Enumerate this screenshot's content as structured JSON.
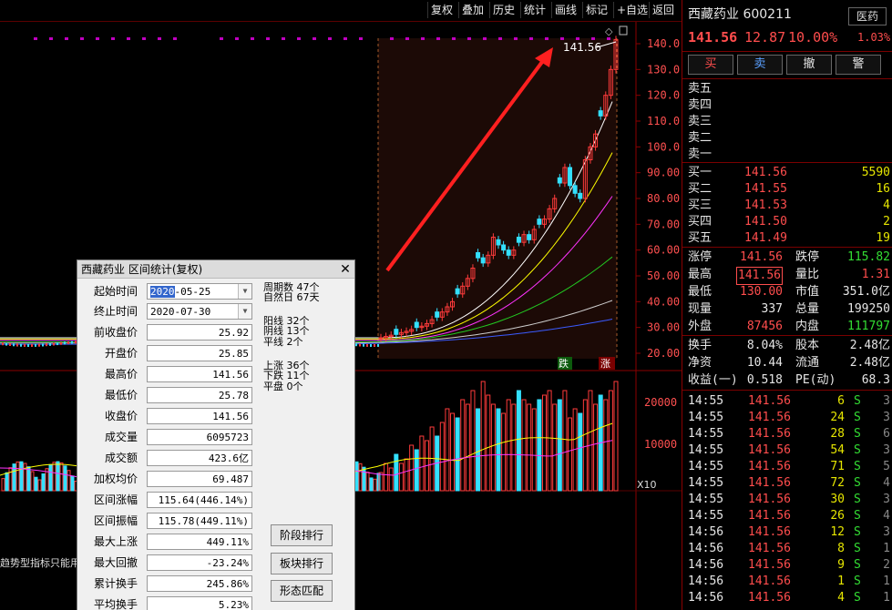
{
  "toolbar": {
    "buttons": [
      "复权",
      "叠加",
      "历史",
      "统计",
      "画线",
      "标记",
      "+自选",
      "返回"
    ]
  },
  "chart": {
    "price_axis": [
      "140.0",
      "130.0",
      "120.0",
      "110.0",
      "100.0",
      "90.00",
      "80.00",
      "70.00",
      "60.00",
      "50.00",
      "40.00",
      "30.00",
      "20.00"
    ],
    "volume_axis": [
      "20000",
      "10000"
    ],
    "volume_unit": "X10",
    "high_label": "141.56",
    "badge_down": "跌",
    "badge_up": "涨",
    "indicator_note": "趋势型指标只能用"
  },
  "panel": {
    "name": "西藏药业 600211",
    "sector": "医药",
    "price": "141.56",
    "change": "12.87",
    "change_pct": "10.00%",
    "turnover_pct": "1.03%",
    "actions": [
      "买",
      "卖",
      "撤",
      "警"
    ],
    "asks": [
      {
        "label": "卖五",
        "price": "",
        "vol": ""
      },
      {
        "label": "卖四",
        "price": "",
        "vol": ""
      },
      {
        "label": "卖三",
        "price": "",
        "vol": ""
      },
      {
        "label": "卖二",
        "price": "",
        "vol": ""
      },
      {
        "label": "卖一",
        "price": "",
        "vol": ""
      }
    ],
    "bids": [
      {
        "label": "买一",
        "price": "141.56",
        "vol": "5590"
      },
      {
        "label": "买二",
        "price": "141.55",
        "vol": "16"
      },
      {
        "label": "买三",
        "price": "141.53",
        "vol": "4"
      },
      {
        "label": "买四",
        "price": "141.50",
        "vol": "2"
      },
      {
        "label": "买五",
        "price": "141.49",
        "vol": "19"
      }
    ],
    "quote": [
      {
        "l1": "涨停",
        "v1": "141.56",
        "l2": "跌停",
        "v2": "115.82"
      },
      {
        "l1": "最高",
        "v1": "141.56",
        "l2": "量比",
        "v2": "1.31"
      },
      {
        "l1": "最低",
        "v1": "130.00",
        "l2": "市值",
        "v2": "351.0亿"
      },
      {
        "l1": "现量",
        "v1": "337",
        "l2": "总量",
        "v2": "199250"
      },
      {
        "l1": "外盘",
        "v1": "87456",
        "l2": "内盘",
        "v2": "111797"
      }
    ],
    "fund": [
      {
        "l1": "换手",
        "v1": "8.04%",
        "l2": "股本",
        "v2": "2.48亿"
      },
      {
        "l1": "净资",
        "v1": "10.44",
        "l2": "流通",
        "v2": "2.48亿"
      },
      {
        "l1": "收益(一)",
        "v1": "0.518",
        "l2": "PE(动)",
        "v2": "68.3"
      }
    ],
    "ticks": [
      {
        "t": "14:55",
        "p": "141.56",
        "v": "6",
        "s": "S",
        "n": "3"
      },
      {
        "t": "14:55",
        "p": "141.56",
        "v": "24",
        "s": "S",
        "n": "3"
      },
      {
        "t": "14:55",
        "p": "141.56",
        "v": "28",
        "s": "S",
        "n": "6"
      },
      {
        "t": "14:55",
        "p": "141.56",
        "v": "54",
        "s": "S",
        "n": "3"
      },
      {
        "t": "14:55",
        "p": "141.56",
        "v": "71",
        "s": "S",
        "n": "5"
      },
      {
        "t": "14:55",
        "p": "141.56",
        "v": "72",
        "s": "S",
        "n": "4"
      },
      {
        "t": "14:55",
        "p": "141.56",
        "v": "30",
        "s": "S",
        "n": "3"
      },
      {
        "t": "14:55",
        "p": "141.56",
        "v": "26",
        "s": "S",
        "n": "4"
      },
      {
        "t": "14:56",
        "p": "141.56",
        "v": "12",
        "s": "S",
        "n": "3"
      },
      {
        "t": "14:56",
        "p": "141.56",
        "v": "8",
        "s": "S",
        "n": "1"
      },
      {
        "t": "14:56",
        "p": "141.56",
        "v": "9",
        "s": "S",
        "n": "2"
      },
      {
        "t": "14:56",
        "p": "141.56",
        "v": "1",
        "s": "S",
        "n": "1"
      },
      {
        "t": "14:56",
        "p": "141.56",
        "v": "4",
        "s": "S",
        "n": "1"
      }
    ]
  },
  "dialog": {
    "title": "西藏药业 区间统计(复权)",
    "start_label": "起始时间",
    "start_value": "2020-05-25",
    "end_label": "终止时间",
    "end_value": "2020-07-30",
    "rows": [
      {
        "label": "前收盘价",
        "value": "25.92"
      },
      {
        "label": "开盘价",
        "value": "25.85"
      },
      {
        "label": "最高价",
        "value": "141.56"
      },
      {
        "label": "最低价",
        "value": "25.78"
      },
      {
        "label": "收盘价",
        "value": "141.56"
      },
      {
        "label": "成交量",
        "value": "6095723"
      },
      {
        "label": "成交额",
        "value": "423.6亿"
      },
      {
        "label": "加权均价",
        "value": "69.487"
      },
      {
        "label": "区间涨幅",
        "value": "115.64(446.14%)"
      },
      {
        "label": "区间振幅",
        "value": "115.78(449.11%)"
      },
      {
        "label": "最大上涨",
        "value": "449.11%"
      },
      {
        "label": "最大回撤",
        "value": "-23.24%"
      },
      {
        "label": "累计换手",
        "value": "245.86%"
      },
      {
        "label": "平均换手",
        "value": "5.23%"
      }
    ],
    "stats": [
      "周期数 47个",
      "自然日 67天",
      "阳线 32个",
      "阴线 13个",
      "平线 2个",
      "上涨 36个",
      "下跌 11个",
      "平盘 0个"
    ],
    "buttons": [
      "阶段排行",
      "板块排行",
      "形态匹配"
    ]
  }
}
